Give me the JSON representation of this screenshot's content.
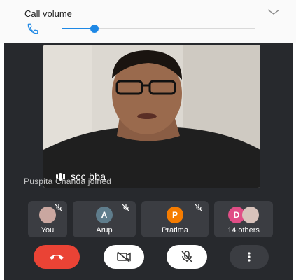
{
  "volume": {
    "title": "Call volume",
    "level": 0.17,
    "accent": "#1e88e5"
  },
  "video": {
    "speaker": "scc bba",
    "toast": "Puspita Chanda joined"
  },
  "participants": [
    {
      "label": "You",
      "initial": "",
      "avatar_color": "#caa7a0",
      "mic_muted": true
    },
    {
      "label": "Arup",
      "initial": "A",
      "avatar_color": "#5f7d8c",
      "mic_muted": true
    },
    {
      "label": "Pratima",
      "initial": "P",
      "avatar_color": "#f57c00",
      "mic_muted": true
    },
    {
      "label": "14 others",
      "initial": "D",
      "avatar_color": "#e04e86",
      "mic_muted": false
    }
  ],
  "controls": {
    "end_call": "end-call",
    "camera": "camera-off",
    "mic": "mic-off",
    "more": "more-options",
    "end_color": "#ea4335"
  }
}
